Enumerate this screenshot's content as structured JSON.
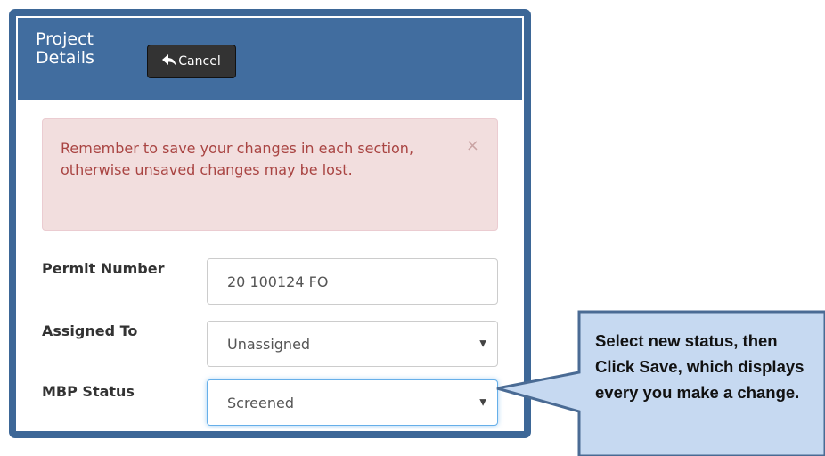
{
  "panel": {
    "title": "Project Details",
    "cancel_label": "Cancel"
  },
  "alert": {
    "message": "Remember to save your changes in each section, otherwise unsaved changes may be lost.",
    "close_symbol": "×"
  },
  "form": {
    "permit_number": {
      "label": "Permit Number",
      "value": "20 100124 FO"
    },
    "assigned_to": {
      "label": "Assigned To",
      "value": "Unassigned"
    },
    "mbp_status": {
      "label": "MBP Status",
      "value": "Screened"
    }
  },
  "callout": {
    "text": "Select new status, then Click Save, which displays every you make a change."
  },
  "colors": {
    "header": "#416d9f",
    "alert_bg": "#f2dede",
    "alert_text": "#a94442",
    "callout_fill": "#c6d9f1",
    "callout_border": "#4a6b94"
  }
}
